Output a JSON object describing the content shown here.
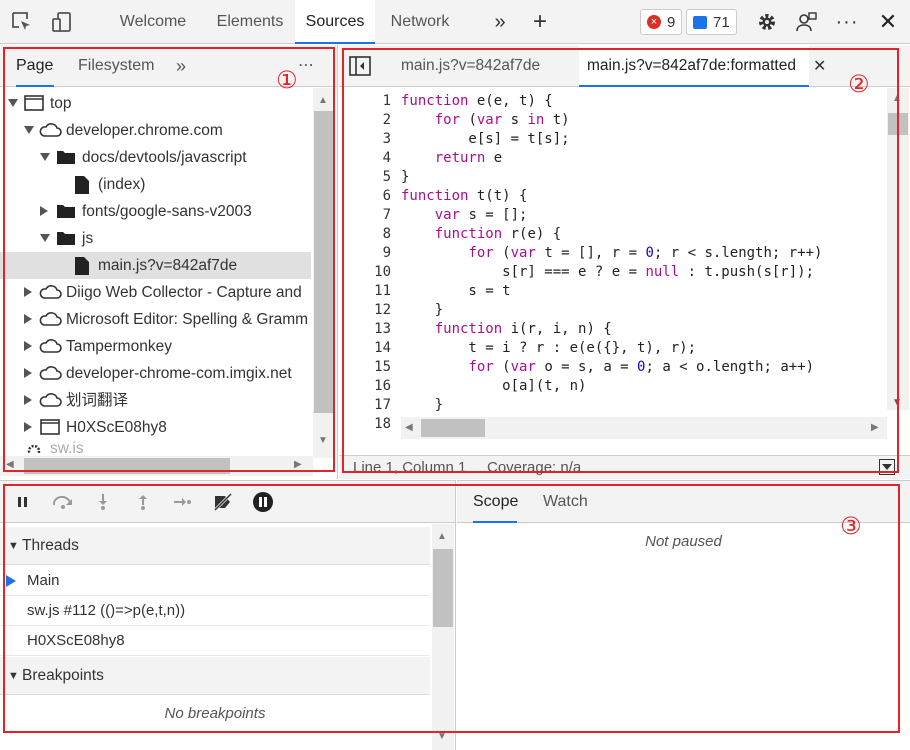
{
  "topbar": {
    "tabs": [
      "Welcome",
      "Elements",
      "Sources",
      "Network"
    ],
    "active_tab": "Sources",
    "error_count": "9",
    "message_count": "71"
  },
  "navigator": {
    "tabs": [
      "Page",
      "Filesystem"
    ],
    "tree": [
      {
        "label": "top"
      },
      {
        "label": "developer.chrome.com"
      },
      {
        "label": "docs/devtools/javascript"
      },
      {
        "label": "(index)"
      },
      {
        "label": "fonts/google-sans-v2003"
      },
      {
        "label": "js"
      },
      {
        "label": "main.js?v=842af7de"
      },
      {
        "label": "Diigo Web Collector - Capture and"
      },
      {
        "label": "Microsoft Editor: Spelling & Gramm"
      },
      {
        "label": "Tampermonkey"
      },
      {
        "label": "developer-chrome-com.imgix.net"
      },
      {
        "label": "划词翻译"
      },
      {
        "label": "H0XScE08hy8"
      },
      {
        "label": "sw.js"
      }
    ]
  },
  "editor": {
    "tabs": [
      "main.js?v=842af7de",
      "main.js?v=842af7de:formatted"
    ],
    "status": "Line 1, Column 1",
    "coverage": "Coverage: n/a"
  },
  "code_lines": [
    {
      "n": "1"
    },
    {
      "n": "2"
    },
    {
      "n": "3"
    },
    {
      "n": "4"
    },
    {
      "n": "5"
    },
    {
      "n": "6"
    },
    {
      "n": "7"
    },
    {
      "n": "8"
    },
    {
      "n": "9"
    },
    {
      "n": "10"
    },
    {
      "n": "11"
    },
    {
      "n": "12"
    },
    {
      "n": "13"
    },
    {
      "n": "14"
    },
    {
      "n": "15"
    },
    {
      "n": "16"
    },
    {
      "n": "17"
    },
    {
      "n": "18"
    }
  ],
  "debugger": {
    "threads_title": "Threads",
    "threads": [
      "Main",
      "sw.js #112 (()=>p(e,t,n))",
      "H0XScE08hy8"
    ],
    "breakpoints_title": "Breakpoints",
    "no_breakpoints": "No breakpoints"
  },
  "scope": {
    "tabs": [
      "Scope",
      "Watch"
    ],
    "not_paused": "Not paused"
  },
  "annotations": [
    "①",
    "②",
    "③"
  ],
  "colors": {
    "accent": "#1a73e8",
    "annotation_red": "#e0242b",
    "keyword": "#aa0d91",
    "number": "#1c00cf",
    "error_red": "#d93025"
  }
}
